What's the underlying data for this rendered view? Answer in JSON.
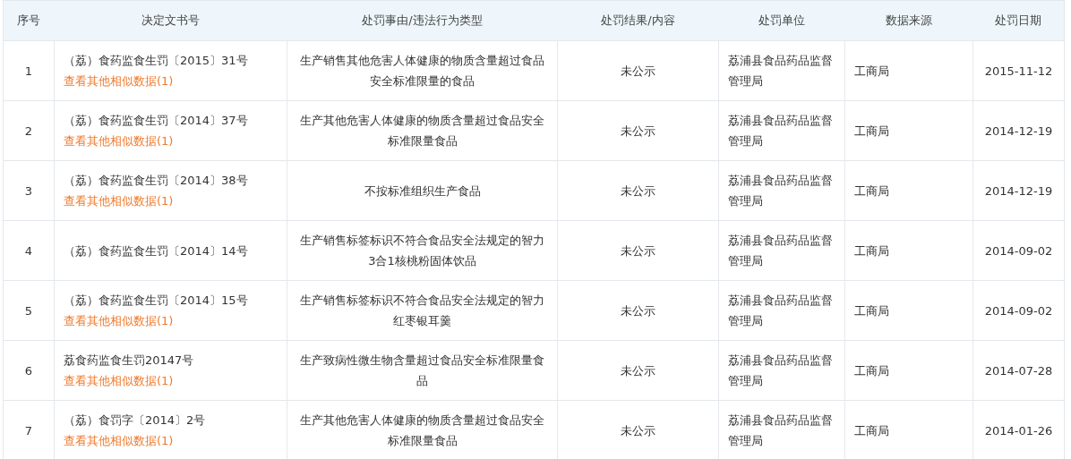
{
  "table": {
    "columns": [
      "序号",
      "决定文书号",
      "处罚事由/违法行为类型",
      "处罚结果/内容",
      "处罚单位",
      "数据来源",
      "处罚日期"
    ],
    "rows": [
      {
        "index": "1",
        "document": "（荔）食药监食生罚〔2015〕31号",
        "similar_link": "查看其他相似数据(1)",
        "reason": "生产销售其他危害人体健康的物质含量超过食品安全标准限量的食品",
        "result": "未公示",
        "unit": "荔浦县食品药品监督管理局",
        "source": "工商局",
        "date": "2015-11-12"
      },
      {
        "index": "2",
        "document": "（荔）食药监食生罚〔2014〕37号",
        "similar_link": "查看其他相似数据(1)",
        "reason": "生产其他危害人体健康的物质含量超过食品安全标准限量食品",
        "result": "未公示",
        "unit": "荔浦县食品药品监督管理局",
        "source": "工商局",
        "date": "2014-12-19"
      },
      {
        "index": "3",
        "document": "（荔）食药监食生罚〔2014〕38号",
        "similar_link": "查看其他相似数据(1)",
        "reason": "不按标准组织生产食品",
        "result": "未公示",
        "unit": "荔浦县食品药品监督管理局",
        "source": "工商局",
        "date": "2014-12-19"
      },
      {
        "index": "4",
        "document": "（荔）食药监食生罚〔2014〕14号",
        "reason": "生产销售标签标识不符合食品安全法规定的智力3合1核桃粉固体饮品",
        "result": "未公示",
        "unit": "荔浦县食品药品监督管理局",
        "source": "工商局",
        "date": "2014-09-02"
      },
      {
        "index": "5",
        "document": "（荔）食药监食生罚〔2014〕15号",
        "similar_link": "查看其他相似数据(1)",
        "reason": "生产销售标签标识不符合食品安全法规定的智力红枣银耳羹",
        "result": "未公示",
        "unit": "荔浦县食品药品监督管理局",
        "source": "工商局",
        "date": "2014-09-02"
      },
      {
        "index": "6",
        "document": "荔食药监食生罚20147号",
        "similar_link": "查看其他相似数据(1)",
        "reason": "生产致病性微生物含量超过食品安全标准限量食品",
        "result": "未公示",
        "unit": "荔浦县食品药品监督管理局",
        "source": "工商局",
        "date": "2014-07-28"
      },
      {
        "index": "7",
        "document": "（荔）食罚字〔2014〕2号",
        "similar_link": "查看其他相似数据(1)",
        "reason": "生产其他危害人体健康的物质含量超过食品安全标准限量食品",
        "result": "未公示",
        "unit": "荔浦县食品药品监督管理局",
        "source": "工商局",
        "date": "2014-01-26"
      }
    ]
  }
}
